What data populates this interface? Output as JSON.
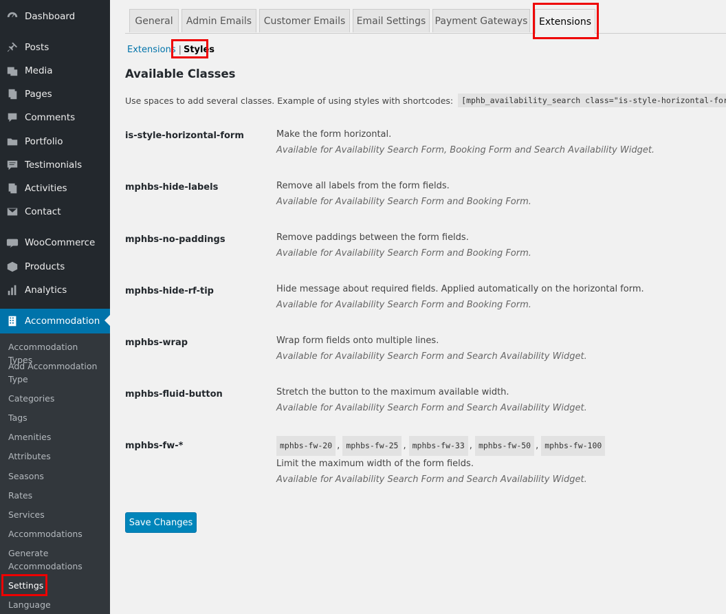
{
  "sidebar": {
    "items": [
      {
        "label": "Dashboard",
        "icon": "dashboard-icon"
      },
      {
        "label": "Posts",
        "icon": "pin-icon"
      },
      {
        "label": "Media",
        "icon": "media-icon"
      },
      {
        "label": "Pages",
        "icon": "pages-icon"
      },
      {
        "label": "Comments",
        "icon": "comment-icon"
      },
      {
        "label": "Portfolio",
        "icon": "folder-icon"
      },
      {
        "label": "Testimonials",
        "icon": "testimonial-icon"
      },
      {
        "label": "Activities",
        "icon": "activities-icon"
      },
      {
        "label": "Contact",
        "icon": "mail-icon"
      },
      {
        "label": "WooCommerce",
        "icon": "woocommerce-icon"
      },
      {
        "label": "Products",
        "icon": "box-icon"
      },
      {
        "label": "Analytics",
        "icon": "bar-chart-icon"
      },
      {
        "label": "Accommodation",
        "icon": "building-icon"
      }
    ],
    "submenu": [
      "Accommodation Types",
      "Add Accommodation Type",
      "Categories",
      "Tags",
      "Amenities",
      "Attributes",
      "Seasons",
      "Rates",
      "Services",
      "Accommodations",
      "Generate Accommodations",
      "Settings",
      "Language"
    ]
  },
  "tabs": [
    "General",
    "Admin Emails",
    "Customer Emails",
    "Email Settings",
    "Payment Gateways",
    "Extensions"
  ],
  "subnav": {
    "link": "Extensions",
    "separator": "|",
    "current": "Styles"
  },
  "heading": "Available Classes",
  "intro": {
    "text": "Use spaces to add several classes. Example of using styles with shortcodes:",
    "code": "[mphb_availability_search class=\"is-style-horizontal-form\"]",
    "after": "."
  },
  "classes": [
    {
      "name": "is-style-horizontal-form",
      "desc": "Make the form horizontal.",
      "note": "Available for Availability Search Form, Booking Form and Search Availability Widget."
    },
    {
      "name": "mphbs-hide-labels",
      "desc": "Remove all labels from the form fields.",
      "note": "Available for Availability Search Form and Booking Form."
    },
    {
      "name": "mphbs-no-paddings",
      "desc": "Remove paddings between the form fields.",
      "note": "Available for Availability Search Form and Booking Form."
    },
    {
      "name": "mphbs-hide-rf-tip",
      "desc": "Hide message about required fields. Applied automatically on the horizontal form.",
      "note": "Available for Availability Search Form and Booking Form."
    },
    {
      "name": "mphbs-wrap",
      "desc": "Wrap form fields onto multiple lines.",
      "note": "Available for Availability Search Form and Search Availability Widget."
    },
    {
      "name": "mphbs-fluid-button",
      "desc": "Stretch the button to the maximum available width.",
      "note": "Available for Availability Search Form and Search Availability Widget."
    },
    {
      "name": "mphbs-fw-*",
      "codes": [
        "mphbs-fw-20",
        "mphbs-fw-25",
        "mphbs-fw-33",
        "mphbs-fw-50",
        "mphbs-fw-100"
      ],
      "desc": "Limit the maximum width of the form fields.",
      "note": "Available for Availability Search Form and Search Availability Widget."
    }
  ],
  "save_label": "Save Changes",
  "colors": {
    "sidebar": "#23282d",
    "submenu": "#32373c",
    "accent": "#0073aa",
    "button": "#0085ba",
    "highlight": "#e00000"
  }
}
